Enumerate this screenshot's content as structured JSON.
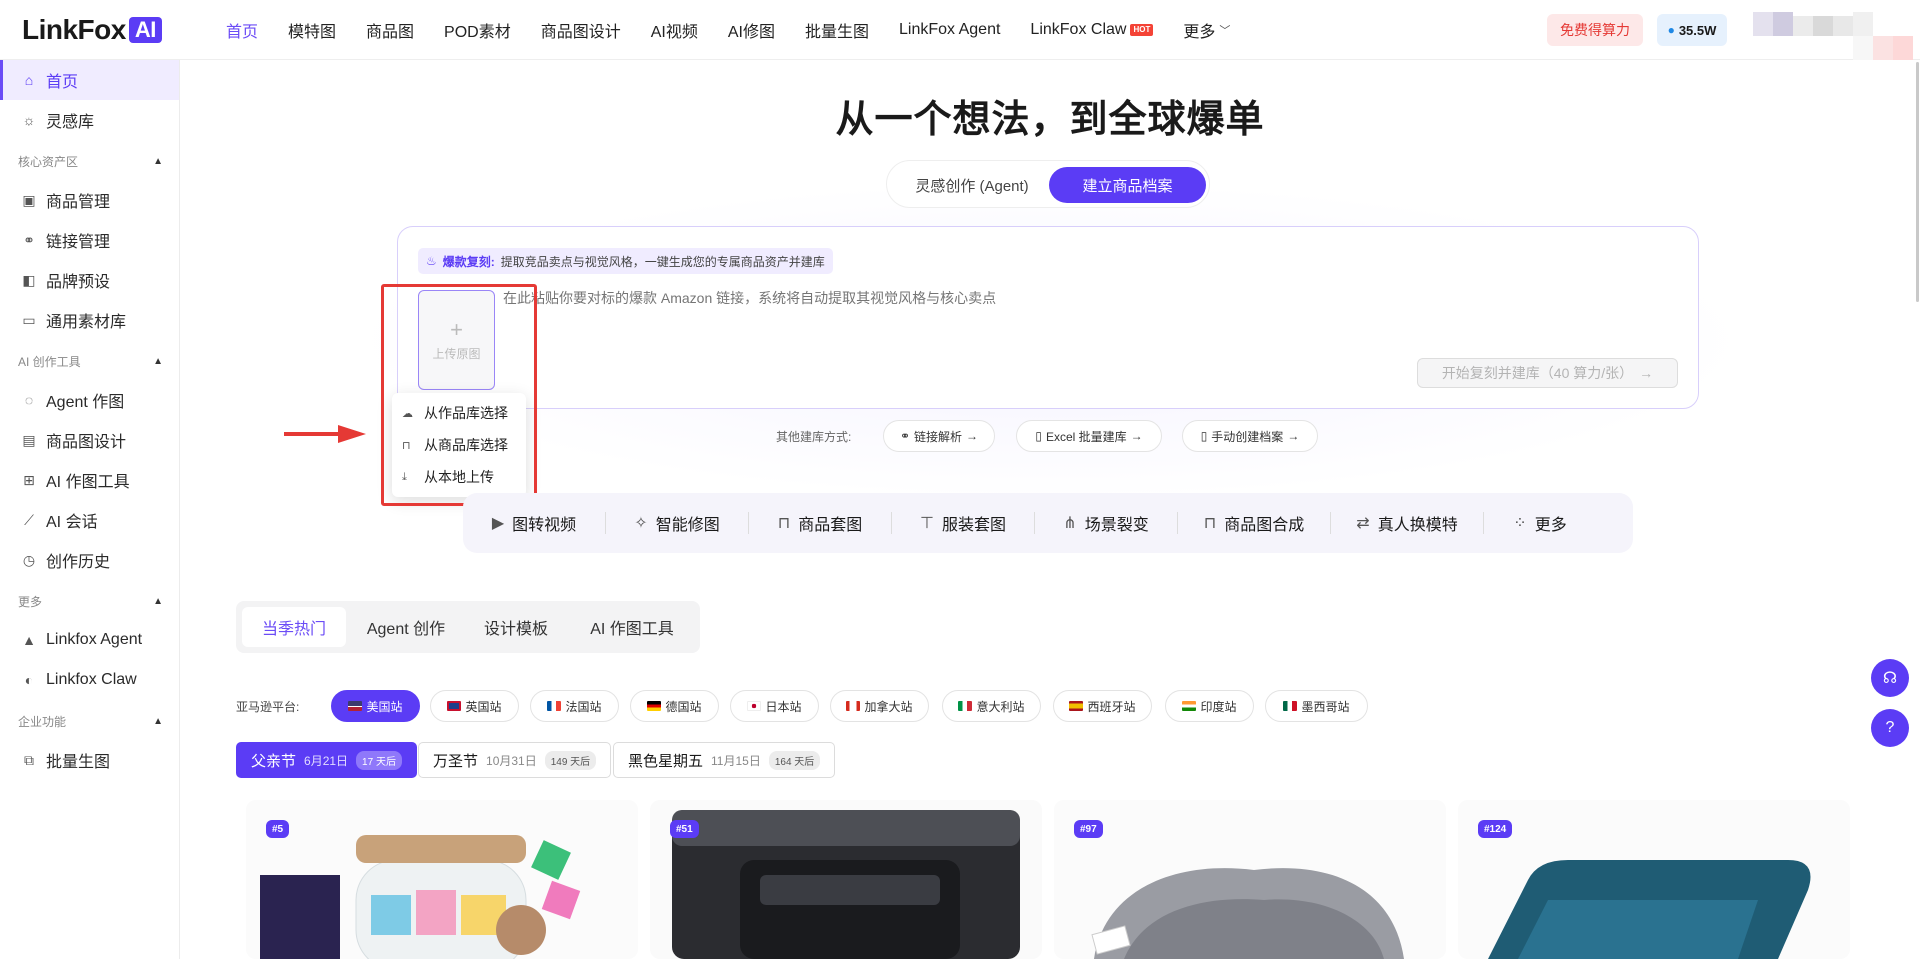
{
  "header": {
    "logo_text": "LinkFox",
    "logo_badge": "AI",
    "nav": [
      {
        "label": "首页",
        "active": true
      },
      {
        "label": "模特图"
      },
      {
        "label": "商品图"
      },
      {
        "label": "POD素材"
      },
      {
        "label": "商品图设计"
      },
      {
        "label": "AI视频"
      },
      {
        "label": "AI修图"
      },
      {
        "label": "批量生图"
      },
      {
        "label": "LinkFox Agent"
      },
      {
        "label": "LinkFox Claw",
        "badge": "HOT"
      },
      {
        "label": "更多",
        "dropdown": true
      }
    ],
    "free_label": "免费得算力",
    "credits": "35.5W"
  },
  "sidebar": {
    "items": [
      {
        "label": "首页",
        "icon": "home-icon",
        "active": true
      },
      {
        "label": "灵感库",
        "icon": "bulb-icon"
      }
    ],
    "groups": [
      {
        "title": "核心资产区",
        "items": [
          {
            "label": "商品管理",
            "icon": "box-icon"
          },
          {
            "label": "链接管理",
            "icon": "link-icon"
          },
          {
            "label": "品牌预设",
            "icon": "palette-icon"
          },
          {
            "label": "通用素材库",
            "icon": "folder-icon"
          }
        ]
      },
      {
        "title": "AI 创作工具",
        "items": [
          {
            "label": "Agent 作图",
            "icon": "agent-icon"
          },
          {
            "label": "商品图设计",
            "icon": "layout-icon"
          },
          {
            "label": "AI 作图工具",
            "icon": "grid-icon"
          },
          {
            "label": "AI 会话",
            "icon": "wand-icon"
          },
          {
            "label": "创作历史",
            "icon": "history-icon"
          }
        ]
      },
      {
        "title": "更多",
        "items": [
          {
            "label": "Linkfox Agent",
            "icon": "mountain-icon"
          },
          {
            "label": "Linkfox Claw",
            "icon": "claw-icon"
          }
        ]
      },
      {
        "title": "企业功能",
        "items": [
          {
            "label": "批量生图",
            "icon": "images-icon"
          }
        ]
      }
    ]
  },
  "hero": {
    "title": "从一个想法，到全球爆单",
    "seg_inactive": "灵感创作 (Agent)",
    "seg_active": "建立商品档案"
  },
  "upload": {
    "tag_key": "爆款复刻:",
    "tag_value": "提取竞品卖点与视觉风格，一键生成您的专属商品资产并建库",
    "upload_label": "上传原图",
    "placeholder": "在此粘贴你要对标的爆款 Amazon 链接，系统将自动提取其视觉风格与核心卖点",
    "start_label": "开始复刻并建库（40 算力/张）"
  },
  "dropdown": {
    "items": [
      {
        "label": "从作品库选择",
        "icon": "cloud-icon"
      },
      {
        "label": "从商品库选择",
        "icon": "bag-icon"
      },
      {
        "label": "从本地上传",
        "icon": "upload-icon"
      }
    ]
  },
  "other": {
    "label": "其他建库方式:",
    "buttons": [
      "链接解析",
      "Excel 批量建库",
      "手动创建档案"
    ]
  },
  "tools": [
    {
      "label": "图转视频",
      "icon": "video-icon"
    },
    {
      "label": "智能修图",
      "icon": "magic-icon"
    },
    {
      "label": "商品套图",
      "icon": "bag-icon"
    },
    {
      "label": "服装套图",
      "icon": "shirt-icon"
    },
    {
      "label": "场景裂变",
      "icon": "split-icon"
    },
    {
      "label": "商品图合成",
      "icon": "bag-icon"
    },
    {
      "label": "真人换模特",
      "icon": "swap-icon"
    },
    {
      "label": "更多",
      "icon": "apps-icon"
    }
  ],
  "tabs": [
    {
      "label": "当季热门",
      "active": true
    },
    {
      "label": "Agent 创作"
    },
    {
      "label": "设计模板"
    },
    {
      "label": "AI 作图工具"
    }
  ],
  "platform": {
    "label": "亚马逊平台:",
    "stations": [
      {
        "label": "美国站",
        "active": true
      },
      {
        "label": "英国站"
      },
      {
        "label": "法国站"
      },
      {
        "label": "德国站"
      },
      {
        "label": "日本站"
      },
      {
        "label": "加拿大站"
      },
      {
        "label": "意大利站"
      },
      {
        "label": "西班牙站"
      },
      {
        "label": "印度站"
      },
      {
        "label": "墨西哥站"
      }
    ]
  },
  "events": [
    {
      "name": "父亲节",
      "date": "6月21日",
      "count": "17 天后",
      "active": true
    },
    {
      "name": "万圣节",
      "date": "10月31日",
      "count": "149 天后"
    },
    {
      "name": "黑色星期五",
      "date": "11月15日",
      "count": "164 天后"
    }
  ],
  "cards": [
    {
      "rank": "#5"
    },
    {
      "rank": "#51"
    },
    {
      "rank": "#97"
    },
    {
      "rank": "#124"
    }
  ],
  "colors": {
    "accent": "#5b3cf5",
    "highlight": "#e53935"
  }
}
